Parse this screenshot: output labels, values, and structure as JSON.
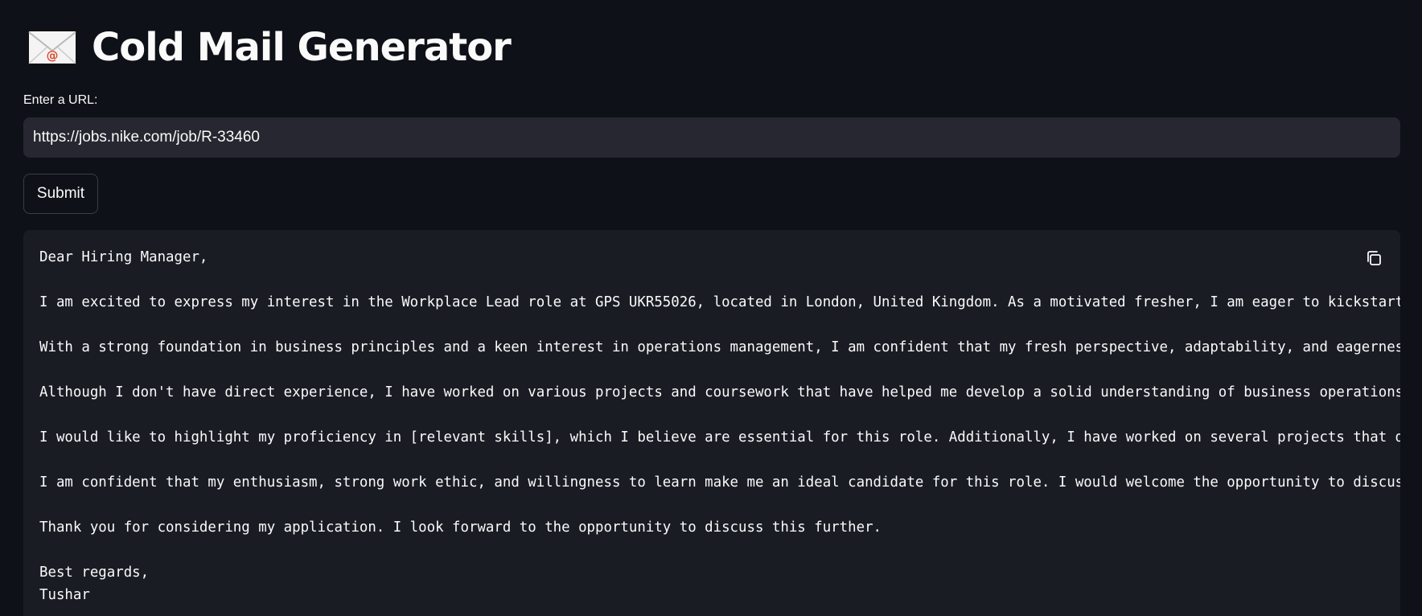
{
  "header": {
    "title": "Cold Mail Generator",
    "icon": "envelope-icon"
  },
  "url_field": {
    "label": "Enter a URL:",
    "value": "https://jobs.nike.com/job/R-33460"
  },
  "submit": {
    "label": "Submit"
  },
  "output": {
    "copy_icon": "copy-icon",
    "lines": [
      "Dear Hiring Manager,",
      "",
      "I am excited to express my interest in the Workplace Lead role at GPS UKR55026, located in London, United Kingdom. As a motivated fresher, I am eager to kickstart",
      "",
      "With a strong foundation in business principles and a keen interest in operations management, I am confident that my fresh perspective, adaptability, and eagerness",
      "",
      "Although I don't have direct experience, I have worked on various projects and coursework that have helped me develop a solid understanding of business operations",
      "",
      "I would like to highlight my proficiency in [relevant skills], which I believe are essential for this role. Additionally, I have worked on several projects that d",
      "",
      "I am confident that my enthusiasm, strong work ethic, and willingness to learn make me an ideal candidate for this role. I would welcome the opportunity to discus",
      "",
      "Thank you for considering my application. I look forward to the opportunity to discuss this further.",
      "",
      "Best regards,",
      "Tushar"
    ]
  }
}
